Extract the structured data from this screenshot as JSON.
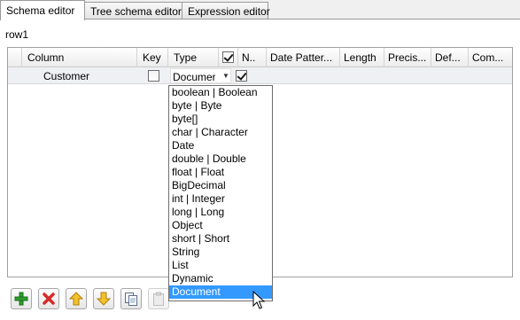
{
  "tabs": [
    "Schema editor",
    "Tree schema editor",
    "Expression editor"
  ],
  "schema_name": "row1",
  "columns": [
    "Column",
    "Key",
    "Type",
    "",
    "N..",
    "Date Patter...",
    "Length",
    "Precis...",
    "Def...",
    "Com..."
  ],
  "row": {
    "column": "Customer",
    "key": false,
    "type": "Documer",
    "nullable": true
  },
  "type_options": [
    "boolean | Boolean",
    "byte | Byte",
    "byte[]",
    "char | Character",
    "Date",
    "double | Double",
    "float | Float",
    "BigDecimal",
    "int | Integer",
    "long | Long",
    "Object",
    "short | Short",
    "String",
    "List",
    "Dynamic",
    "Document"
  ],
  "selected_option": "Document",
  "toolbar_icons": [
    "add-icon",
    "remove-icon",
    "move-up-icon",
    "move-down-icon",
    "copy-icon",
    "paste-icon"
  ],
  "colors": {
    "selection": "#3399ff",
    "add": "#2e9e2e",
    "remove": "#d62a2a",
    "arrow": "#e8b20f"
  }
}
